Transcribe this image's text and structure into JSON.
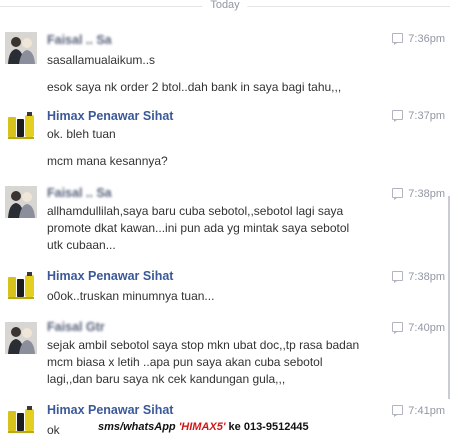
{
  "divider": {
    "label": "Today"
  },
  "messages": [
    {
      "sender": "Faisal .. Sa",
      "time": "7:36pm",
      "lines": [
        "sasallamualaikum..s",
        "esok saya nk order 2 btol..dah bank in saya bagi tahu,,,"
      ]
    },
    {
      "sender": "Himax Penawar Sihat",
      "time": "7:37pm",
      "lines": [
        "ok. bleh tuan",
        "mcm mana kesannya?"
      ]
    },
    {
      "sender": "Faisal .. Sa",
      "time": "7:38pm",
      "lines": [
        "allhamdullilah,saya baru cuba sebotol,,sebotol lagi saya",
        "promote dkat kawan...ini pun ada yg mintak saya sebotol",
        "utk cubaan..."
      ]
    },
    {
      "sender": "Himax Penawar Sihat",
      "time": "7:38pm",
      "lines": [
        "o0ok..truskan minumnya tuan..."
      ]
    },
    {
      "sender": "Faisal Gtr",
      "time": "7:40pm",
      "lines": [
        "sejak ambil sebotol saya stop mkn ubat doc,,tp rasa badan",
        "mcm biasa x letih ..apa pun saya akan cuba sebotol",
        "lagi,,dan baru saya nk cek kandungan gula,,,"
      ]
    },
    {
      "sender": "Himax Penawar Sihat",
      "time": "7:41pm",
      "lines": [
        "ok"
      ]
    }
  ],
  "watermark": {
    "prefix": "sms/whatsApp ",
    "code": "'HIMAX5'",
    "suffix": " ke 013-9512445"
  },
  "colors": {
    "sender": "#3b5998",
    "time": "#9197a3",
    "text": "#333333",
    "watermark_code": "#d01717"
  }
}
